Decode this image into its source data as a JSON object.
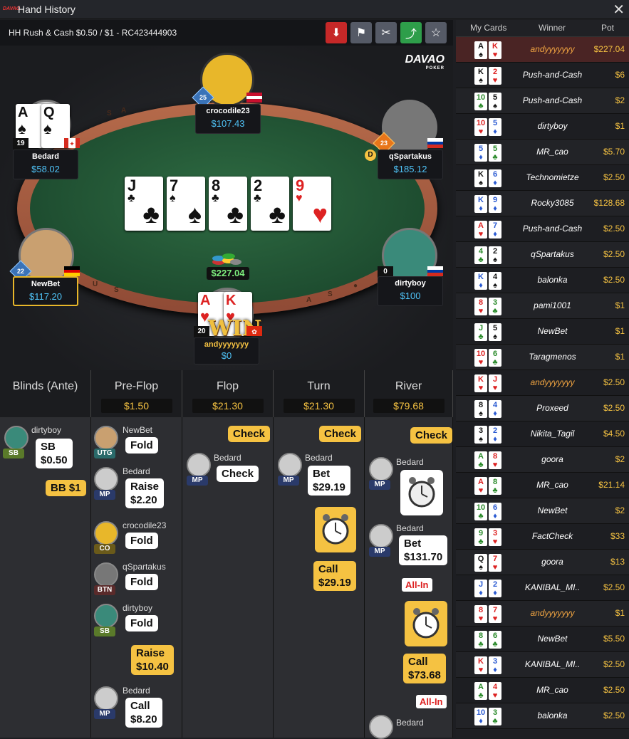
{
  "window": {
    "title": "Hand History",
    "logo": "DAVAO"
  },
  "header": {
    "text": "HH  Rush & Cash $0.50 / $1   - RC423444903",
    "buttons": [
      {
        "name": "download-icon",
        "color": "#c62828",
        "glyph": "⬇"
      },
      {
        "name": "flag-icon",
        "color": "#555a66",
        "glyph": "⚑"
      },
      {
        "name": "hide-icon",
        "color": "#555a66",
        "glyph": "✂"
      },
      {
        "name": "share-icon",
        "color": "#2e9e4a",
        "glyph": "⤴"
      },
      {
        "name": "star-icon",
        "color": "#555a66",
        "glyph": "☆"
      }
    ]
  },
  "brand": {
    "name": "DAVAO",
    "sub": "POKER"
  },
  "board": [
    {
      "rank": "J",
      "suit": "♣",
      "color": "#111"
    },
    {
      "rank": "7",
      "suit": "♠",
      "color": "#111"
    },
    {
      "rank": "8",
      "suit": "♣",
      "color": "#111"
    },
    {
      "rank": "2",
      "suit": "♣",
      "color": "#111"
    },
    {
      "rank": "9",
      "suit": "♥",
      "color": "#d22"
    }
  ],
  "pot": "$227.04",
  "players": {
    "crocodile": {
      "name": "crocodile23",
      "stack": "$107.43",
      "level": "25"
    },
    "bedard": {
      "name": "Bedard",
      "stack": "$58.02",
      "level": "19"
    },
    "qspartakus": {
      "name": "qSpartakus",
      "stack": "$185.12",
      "level": "23"
    },
    "newbet": {
      "name": "NewBet",
      "stack": "$117.20",
      "level": "22"
    },
    "dirtyboy": {
      "name": "dirtyboy",
      "stack": "$100",
      "level": "0"
    },
    "andy": {
      "name": "andyyyyyyy",
      "stack": "$0",
      "level": "20",
      "badge": "WIN"
    }
  },
  "bedard_cards": [
    {
      "rank": "A",
      "suit": "♠"
    },
    {
      "rank": "Q",
      "suit": "♠"
    }
  ],
  "andy_cards": [
    {
      "rank": "A",
      "suit": "♥"
    },
    {
      "rank": "K",
      "suit": "♥"
    }
  ],
  "streets": [
    {
      "title": "Blinds (Ante)",
      "amount": ""
    },
    {
      "title": "Pre-Flop",
      "amount": "$1.50"
    },
    {
      "title": "Flop",
      "amount": "$21.30"
    },
    {
      "title": "Turn",
      "amount": "$21.30"
    },
    {
      "title": "River",
      "amount": "$79.68"
    }
  ],
  "act": {
    "blinds": {
      "name": "dirtyboy",
      "pos": "SB",
      "sb": "SB",
      "sb_amt": "$0.50",
      "bb": "BB  $1"
    },
    "pre": [
      {
        "name": "NewBet",
        "pos": "UTG",
        "act": "Fold",
        "amt": ""
      },
      {
        "name": "Bedard",
        "pos": "MP",
        "act": "Raise",
        "amt": "$2.20"
      },
      {
        "name": "crocodile23",
        "pos": "CO",
        "act": "Fold",
        "amt": ""
      },
      {
        "name": "qSpartakus",
        "pos": "BTN",
        "act": "Fold",
        "amt": ""
      },
      {
        "name": "dirtyboy",
        "pos": "SB",
        "act": "Fold",
        "amt": ""
      },
      {
        "name": "Bedard",
        "pos": "MP",
        "act": "Call",
        "amt": "$8.20"
      }
    ],
    "pre_raise": {
      "act": "Raise",
      "amt": "$10.40"
    },
    "flop": {
      "check_y": "Check",
      "name": "Bedard",
      "pos": "MP",
      "check_w": "Check"
    },
    "turn": {
      "check_y": "Check",
      "name": "Bedard",
      "pos": "MP",
      "bet": "Bet",
      "bet_amt": "$29.19",
      "call": "Call",
      "call_amt": "$29.19"
    },
    "river": {
      "check_y": "Check",
      "name1": "Bedard",
      "pos1": "MP",
      "name2": "Bedard",
      "pos2": "MP",
      "bet": "Bet",
      "bet_amt": "$131.70",
      "allin1": "All-In",
      "call": "Call",
      "call_amt": "$73.68",
      "allin2": "All-In",
      "name3": "Bedard"
    }
  },
  "sidebar": {
    "cols": [
      "My Cards",
      "Winner",
      "Pot"
    ],
    "rows": [
      {
        "c1": "A",
        "s1": "♠",
        "k1": "#111",
        "c2": "K",
        "s2": "♥",
        "k2": "#d22",
        "winner": "andyyyyyyy",
        "pot": "$227.04",
        "me": true
      },
      {
        "c1": "K",
        "s1": "♠",
        "k1": "#111",
        "c2": "2",
        "s2": "♥",
        "k2": "#d22",
        "winner": "Push-and-Cash",
        "pot": "$6"
      },
      {
        "c1": "10",
        "s1": "♣",
        "k1": "#2a8a2a",
        "c2": "5",
        "s2": "♠",
        "k2": "#111",
        "winner": "Push-and-Cash",
        "pot": "$2"
      },
      {
        "c1": "10",
        "s1": "♥",
        "k1": "#d22",
        "c2": "5",
        "s2": "♦",
        "k2": "#2a5ad2",
        "winner": "dirtyboy",
        "pot": "$1"
      },
      {
        "c1": "5",
        "s1": "♦",
        "k1": "#2a5ad2",
        "c2": "5",
        "s2": "♣",
        "k2": "#2a8a2a",
        "winner": "MR_cao",
        "pot": "$5.70"
      },
      {
        "c1": "K",
        "s1": "♠",
        "k1": "#111",
        "c2": "6",
        "s2": "♦",
        "k2": "#2a5ad2",
        "winner": "Technomietze",
        "pot": "$2.50"
      },
      {
        "c1": "K",
        "s1": "♦",
        "k1": "#2a5ad2",
        "c2": "9",
        "s2": "♦",
        "k2": "#2a5ad2",
        "winner": "Rocky3085",
        "pot": "$128.68"
      },
      {
        "c1": "A",
        "s1": "♥",
        "k1": "#d22",
        "c2": "7",
        "s2": "♦",
        "k2": "#2a5ad2",
        "winner": "Push-and-Cash",
        "pot": "$2.50"
      },
      {
        "c1": "4",
        "s1": "♣",
        "k1": "#2a8a2a",
        "c2": "2",
        "s2": "♠",
        "k2": "#111",
        "winner": "qSpartakus",
        "pot": "$2.50"
      },
      {
        "c1": "K",
        "s1": "♦",
        "k1": "#2a5ad2",
        "c2": "4",
        "s2": "♠",
        "k2": "#111",
        "winner": "balonka",
        "pot": "$2.50"
      },
      {
        "c1": "8",
        "s1": "♥",
        "k1": "#d22",
        "c2": "3",
        "s2": "♣",
        "k2": "#2a8a2a",
        "winner": "pami1001",
        "pot": "$1"
      },
      {
        "c1": "J",
        "s1": "♣",
        "k1": "#2a8a2a",
        "c2": "5",
        "s2": "♠",
        "k2": "#111",
        "winner": "NewBet",
        "pot": "$1"
      },
      {
        "c1": "10",
        "s1": "♥",
        "k1": "#d22",
        "c2": "6",
        "s2": "♣",
        "k2": "#2a8a2a",
        "winner": "Taragmenos",
        "pot": "$1"
      },
      {
        "c1": "K",
        "s1": "♥",
        "k1": "#d22",
        "c2": "J",
        "s2": "♥",
        "k2": "#d22",
        "winner": "andyyyyyyy",
        "pot": "$2.50",
        "me": true
      },
      {
        "c1": "8",
        "s1": "♠",
        "k1": "#111",
        "c2": "4",
        "s2": "♦",
        "k2": "#2a5ad2",
        "winner": "Proxeed",
        "pot": "$2.50"
      },
      {
        "c1": "3",
        "s1": "♠",
        "k1": "#111",
        "c2": "2",
        "s2": "♦",
        "k2": "#2a5ad2",
        "winner": "Nikita_Tagil",
        "pot": "$4.50"
      },
      {
        "c1": "A",
        "s1": "♣",
        "k1": "#2a8a2a",
        "c2": "8",
        "s2": "♥",
        "k2": "#d22",
        "winner": "goora",
        "pot": "$2"
      },
      {
        "c1": "A",
        "s1": "♥",
        "k1": "#d22",
        "c2": "8",
        "s2": "♣",
        "k2": "#2a8a2a",
        "winner": "MR_cao",
        "pot": "$21.14"
      },
      {
        "c1": "10",
        "s1": "♣",
        "k1": "#2a8a2a",
        "c2": "6",
        "s2": "♦",
        "k2": "#2a5ad2",
        "winner": "NewBet",
        "pot": "$2"
      },
      {
        "c1": "9",
        "s1": "♣",
        "k1": "#2a8a2a",
        "c2": "3",
        "s2": "♥",
        "k2": "#d22",
        "winner": "FactCheck",
        "pot": "$33"
      },
      {
        "c1": "Q",
        "s1": "♠",
        "k1": "#111",
        "c2": "7",
        "s2": "♥",
        "k2": "#d22",
        "winner": "goora",
        "pot": "$13"
      },
      {
        "c1": "J",
        "s1": "♦",
        "k1": "#2a5ad2",
        "c2": "2",
        "s2": "♦",
        "k2": "#2a5ad2",
        "winner": "KANIBAL_MI..",
        "pot": "$2.50"
      },
      {
        "c1": "8",
        "s1": "♥",
        "k1": "#d22",
        "c2": "7",
        "s2": "♥",
        "k2": "#d22",
        "winner": "andyyyyyyy",
        "pot": "$1",
        "me": true
      },
      {
        "c1": "8",
        "s1": "♣",
        "k1": "#2a8a2a",
        "c2": "6",
        "s2": "♣",
        "k2": "#2a8a2a",
        "winner": "NewBet",
        "pot": "$5.50"
      },
      {
        "c1": "K",
        "s1": "♥",
        "k1": "#d22",
        "c2": "3",
        "s2": "♦",
        "k2": "#2a5ad2",
        "winner": "KANIBAL_MI..",
        "pot": "$2.50"
      },
      {
        "c1": "A",
        "s1": "♣",
        "k1": "#2a8a2a",
        "c2": "4",
        "s2": "♥",
        "k2": "#d22",
        "winner": "MR_cao",
        "pot": "$2.50"
      },
      {
        "c1": "10",
        "s1": "♦",
        "k1": "#2a5ad2",
        "c2": "3",
        "s2": "♣",
        "k2": "#2a8a2a",
        "winner": "balonka",
        "pot": "$2.50"
      }
    ]
  }
}
